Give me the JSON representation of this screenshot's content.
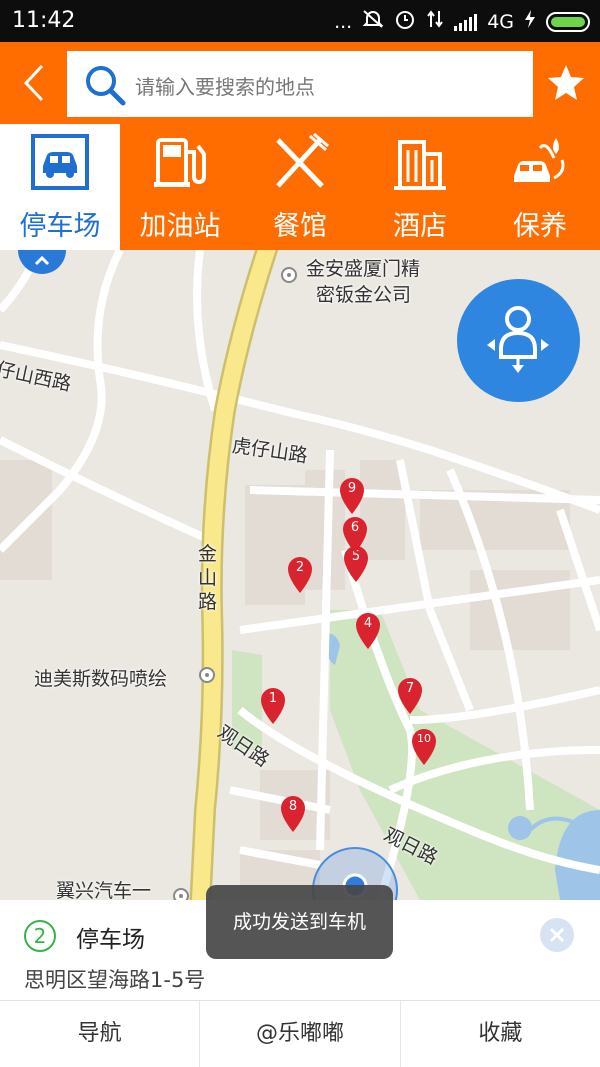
{
  "status_bar": {
    "time": "11:42",
    "dots": "...",
    "network": "4G"
  },
  "header": {
    "search_placeholder": "请输入要搜索的地点"
  },
  "categories": [
    {
      "label": "停车场",
      "icon": "car-icon"
    },
    {
      "label": "加油站",
      "icon": "gas-pump-icon"
    },
    {
      "label": "餐馆",
      "icon": "fork-knife-icon"
    },
    {
      "label": "酒店",
      "icon": "building-icon"
    },
    {
      "label": "保养",
      "icon": "car-wash-icon"
    }
  ],
  "map": {
    "labels": {
      "poi_company_line1": "金安盛厦门精",
      "poi_company_line2": "密钣金公司",
      "road_west": "仔山西路",
      "road_huzaishan": "虎仔山路",
      "road_jinshan": "金山路",
      "poi_dimeisi": "迪美斯数码喷绘",
      "road_guanri_1": "观日路",
      "road_guanri_2": "观日路",
      "poi_yixing": "翼兴汽车一"
    },
    "pins": [
      "1",
      "2",
      "4",
      "5",
      "6",
      "7",
      "8",
      "9",
      "10"
    ]
  },
  "info": {
    "index": "2",
    "title": "停车场",
    "address": "思明区望海路1-5号"
  },
  "actions": {
    "navigate": "导航",
    "share": "@乐嘟嘟",
    "favorite": "收藏"
  },
  "toast": "成功发送到车机",
  "colors": {
    "brand_orange": "#ff6c00",
    "active_blue": "#1e6fd1",
    "pin_red": "#d9232e",
    "park_green": "#cfe4c0",
    "main_road_yellow": "#f9e88c"
  }
}
